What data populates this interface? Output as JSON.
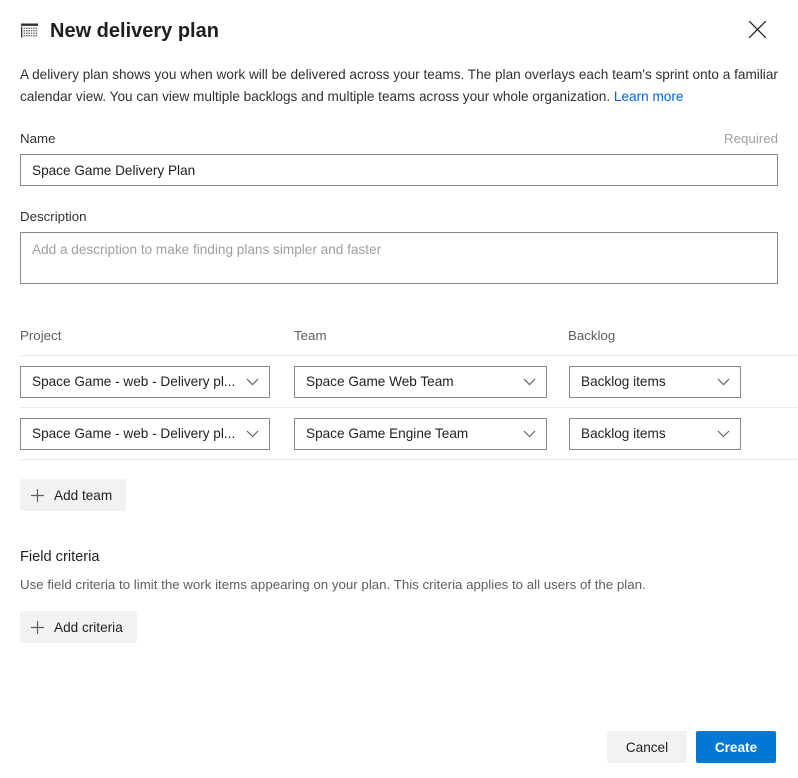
{
  "dialog": {
    "title": "New delivery plan",
    "icon": "plan-grid-icon",
    "close_icon": "close-icon",
    "intro_text": "A delivery plan shows you when work will be delivered across your teams. The plan overlays each team's sprint onto a familiar calendar view. You can view multiple backlogs and multiple teams across your whole organization. ",
    "intro_link": "Learn more"
  },
  "name_field": {
    "label": "Name",
    "required_tag": "Required",
    "value": "Space Game Delivery Plan",
    "placeholder": ""
  },
  "description_field": {
    "label": "Description",
    "value": "",
    "placeholder": "Add a description to make finding plans simpler and faster"
  },
  "teams": {
    "columns": [
      "Project",
      "Team",
      "Backlog"
    ],
    "rows": [
      {
        "project": "Space Game - web - Delivery pl...",
        "team": "Space Game Web Team",
        "backlog": "Backlog items"
      },
      {
        "project": "Space Game - web - Delivery pl...",
        "team": "Space Game Engine Team",
        "backlog": "Backlog items"
      }
    ],
    "add_team_label": "Add team",
    "add_icon": "plus-icon",
    "chevron_icon": "chevron-down-icon"
  },
  "field_criteria": {
    "title": "Field criteria",
    "description": "Use field criteria to limit the work items appearing on your plan. This criteria applies to all users of the plan.",
    "add_criteria_label": "Add criteria"
  },
  "footer": {
    "cancel_label": "Cancel",
    "create_label": "Create"
  },
  "colors": {
    "primary": "#0078d4",
    "link": "#0366d6",
    "neutral_button": "#f3f2f1",
    "border": "#8a8886",
    "divider": "#edebe9"
  }
}
